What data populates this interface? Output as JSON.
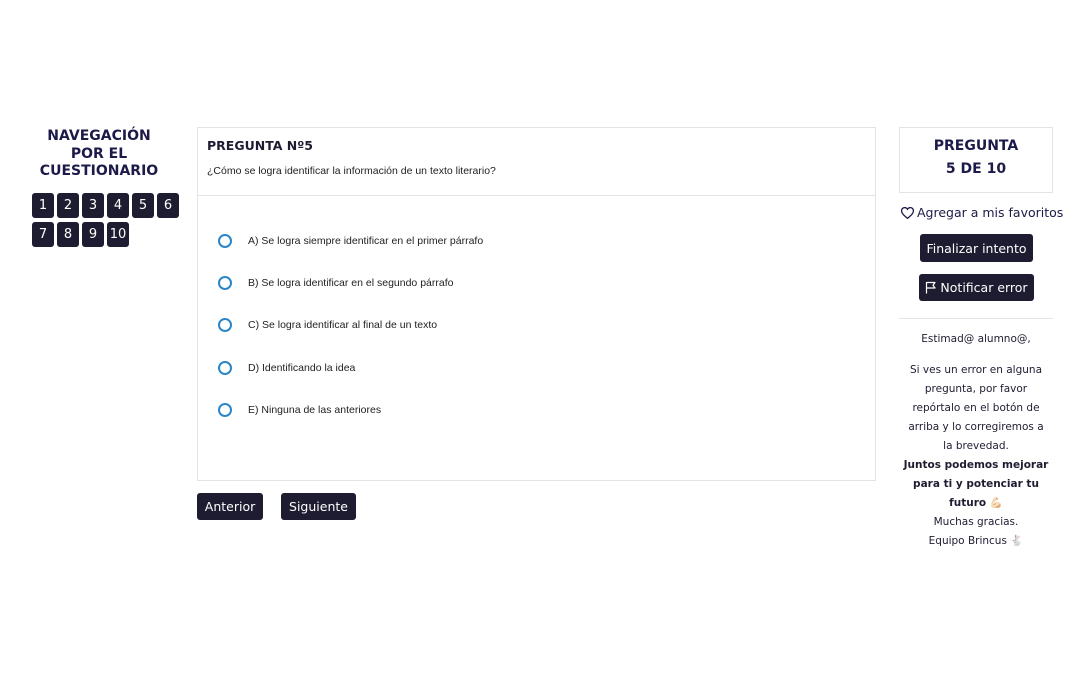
{
  "nav": {
    "title_lines": [
      "NAVEGACIÓN",
      "POR EL",
      "CUESTIONARIO"
    ],
    "questions": [
      "1",
      "2",
      "3",
      "4",
      "5",
      "6",
      "7",
      "8",
      "9",
      "10"
    ]
  },
  "question": {
    "number_label": "PREGUNTA Nº5",
    "text": "¿Cómo se logra identificar la información de un texto literario?",
    "options": [
      "A) Se logra siempre identificar en el primer párrafo",
      "B) Se logra identificar en el segundo párrafo",
      "C) Se logra identificar al final de un texto",
      "D) Identificando la idea",
      "E) Ninguna de las anteriores"
    ]
  },
  "pager": {
    "prev_label": "Anterior",
    "next_label": "Siguiente"
  },
  "progress": {
    "line1": "PREGUNTA",
    "line2": "5 DE 10"
  },
  "actions": {
    "favorite_label": "Agregar a mis favoritos",
    "finish_label": "Finalizar intento",
    "report_label": "Notificar error"
  },
  "notice": {
    "greeting": "Estimad@ alumno@,",
    "body_lines": [
      "Si ves un error en alguna",
      "pregunta, por favor",
      "repórtalo en el botón de",
      "arriba y lo corregiremos a",
      "la brevedad."
    ],
    "bold_lines": [
      "Juntos podemos mejorar",
      "para ti y potenciar tu",
      "futuro 💪🏻"
    ],
    "thanks": "Muchas gracias.",
    "signature": "Equipo Brincus 🐇"
  },
  "colors": {
    "dark": "#1e1c30",
    "navy": "#1c1a48",
    "radio": "#2a86c8",
    "border": "#e3e3e6"
  }
}
